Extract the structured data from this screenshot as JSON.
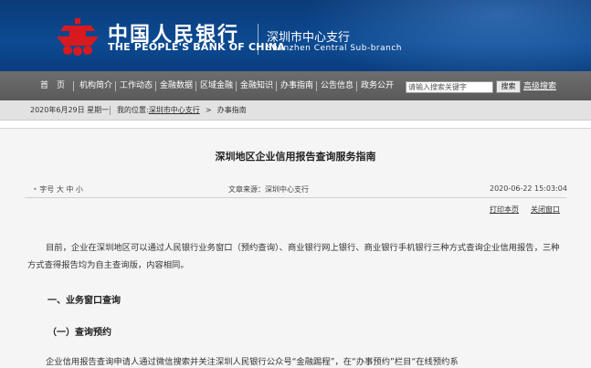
{
  "header": {
    "bank_name_cn": "中国人民银行",
    "bank_name_en": "THE PEOPLE'S BANK OF CHINA",
    "branch_cn": "深圳市中心支行",
    "branch_en": "Shenzhen Central Sub-branch",
    "emblem_color": "#d71920"
  },
  "nav": {
    "items": [
      "首　页",
      "机构简介",
      "工作动态",
      "金融数据",
      "区域金融",
      "金融知识",
      "办事指南",
      "公告信息",
      "政务公开"
    ],
    "search_placeholder": "请输入搜索关键字",
    "search_button": "搜索",
    "advanced_search": "高级搜索"
  },
  "breadcrumb": {
    "date": "2020年6月29日  星期一",
    "location_label": "我的位置:",
    "home": "深圳市中心支行",
    "arrow": ">",
    "current": "办事指南"
  },
  "article": {
    "title": "深圳地区企业信用报告查询服务指南",
    "font_size_label": "字号",
    "font_sizes": [
      "大",
      "中",
      "小"
    ],
    "source": "文章来源：深圳中心支行",
    "datetime": "2020-06-22 15:03:04",
    "print_label": "打印本页",
    "close_label": "关闭窗口",
    "paragraph1": "目前，企业在深圳地区可以通过人民银行业务窗口（预约查询）、商业银行网上银行、商业银行手机银行三种方式查询企业信用报告，三种方式查得报告均为自主查询版，内容相同。",
    "heading1": "一、业务窗口查询",
    "heading2": "（一）查询预约",
    "paragraph2": "企业信用报告查询申请人通过微信搜索并关注深圳人民银行公众号“金融踢程”，在“办事预约”栏目“在线预约系"
  }
}
